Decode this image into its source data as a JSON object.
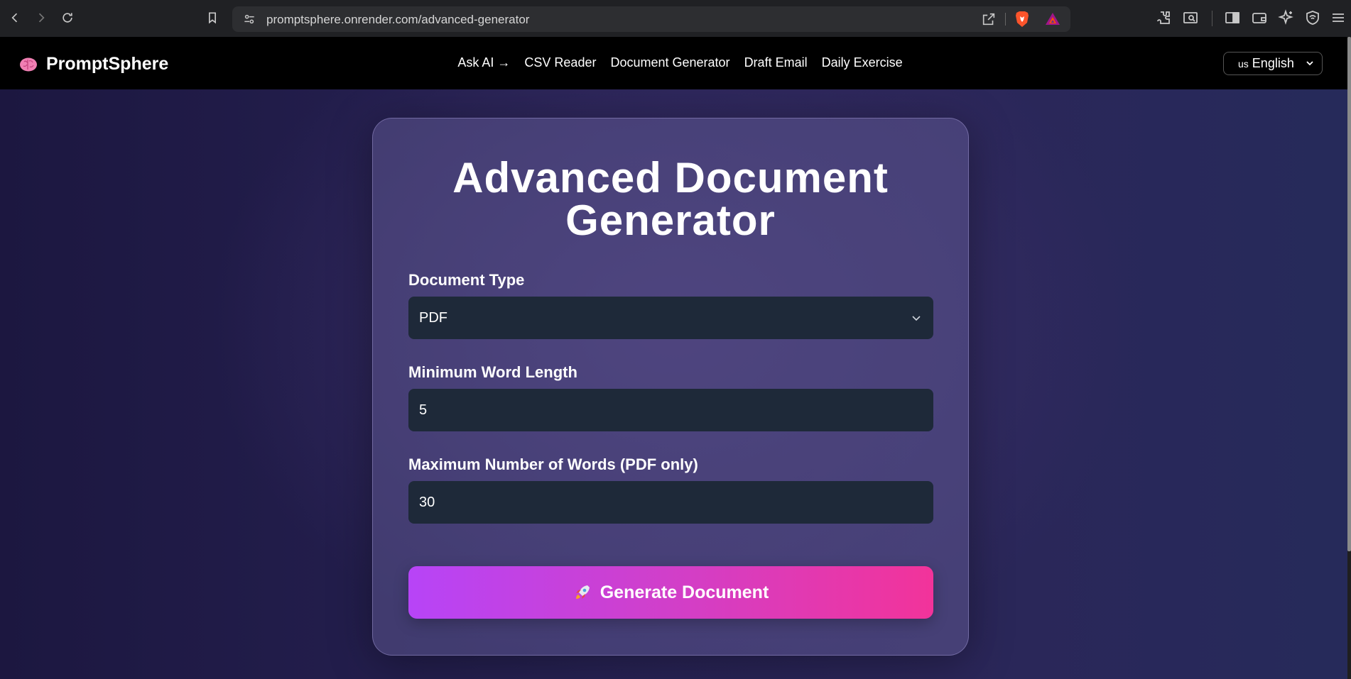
{
  "browser": {
    "url": "promptsphere.onrender.com/advanced-generator"
  },
  "header": {
    "brand": "PromptSphere",
    "nav": [
      "Ask AI →",
      "CSV Reader",
      "Document Generator",
      "Draft Email",
      "Daily Exercise"
    ],
    "language": {
      "flag_text": "us",
      "label": "English"
    }
  },
  "form": {
    "title": "Advanced Document Generator",
    "document_type_label": "Document Type",
    "document_type_value": "PDF",
    "min_word_label": "Minimum Word Length",
    "min_word_value": "5",
    "max_words_label": "Maximum Number of Words (PDF only)",
    "max_words_value": "30",
    "generate_label": "Generate Document"
  },
  "colors": {
    "button_start": "#b744f7",
    "button_end": "#f2339a",
    "field_bg": "#1e2939",
    "header_bg": "#000000"
  }
}
